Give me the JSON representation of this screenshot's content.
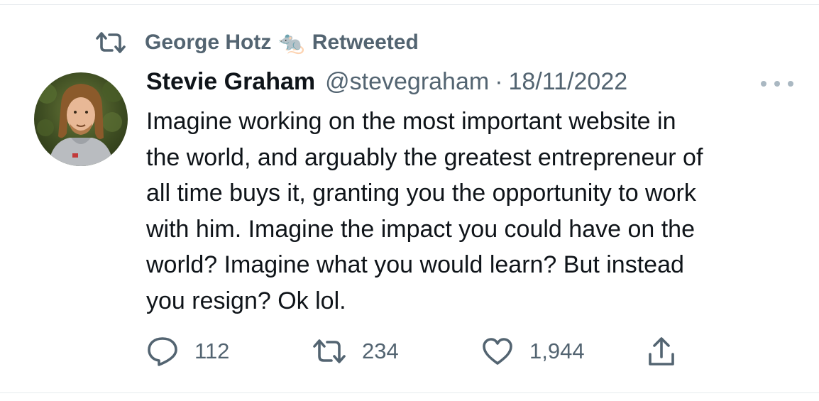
{
  "retweet_context": {
    "retweeter_name": "George Hotz",
    "emoji": "🐀",
    "label": "Retweeted"
  },
  "tweet": {
    "author": {
      "display_name": "Stevie Graham",
      "handle": "@stevegraham",
      "avatar_icon": "avatar-photo"
    },
    "separator": "·",
    "date": "18/11/2022",
    "text_lines": [
      "Imagine working on the most important website in",
      "the world, and arguably the greatest entrepreneur of",
      "all time buys it, granting you the opportunity to work",
      "with him. Imagine the impact you could have on the",
      "world? Imagine what you would learn? But instead",
      "you resign? Ok lol."
    ]
  },
  "actions": {
    "reply": {
      "icon": "reply-icon",
      "count": "112"
    },
    "retweet": {
      "icon": "retweet-icon",
      "count": "234"
    },
    "like": {
      "icon": "heart-icon",
      "count": "1,944"
    },
    "share": {
      "icon": "share-icon"
    }
  },
  "colors": {
    "text_primary": "#0f1419",
    "text_secondary": "#536471",
    "divider": "#e7ebee"
  }
}
